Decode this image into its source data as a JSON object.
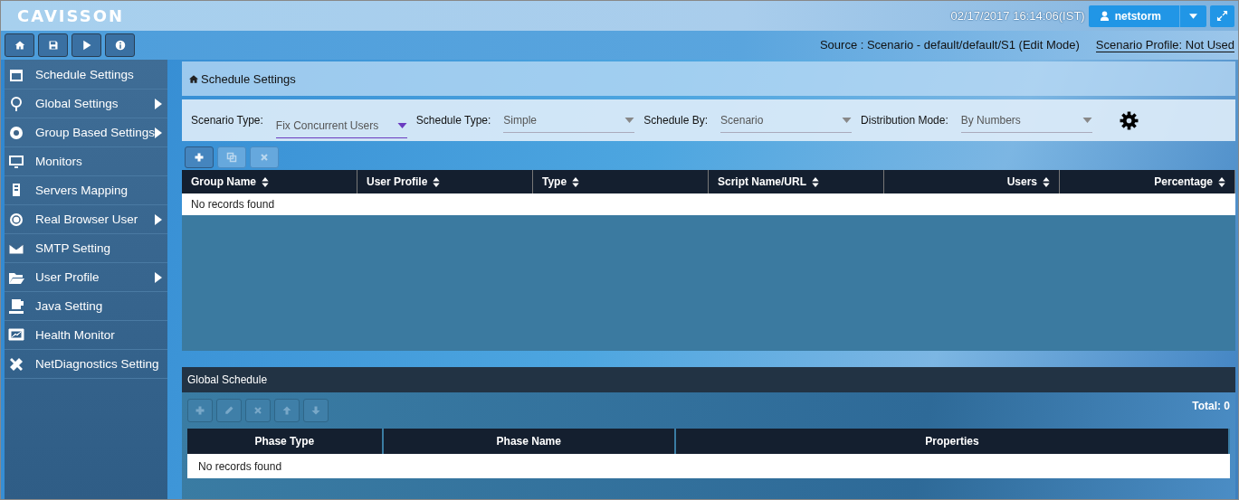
{
  "header": {
    "logo": "CAVISSON",
    "datetime": "02/17/2017 16:14:06(IST)",
    "user": "netstorm"
  },
  "source": "Source : Scenario - default/default/S1 (Edit Mode)",
  "scenario_profile": "Scenario Profile: Not Used",
  "sidebar": {
    "items": [
      {
        "label": "Schedule Settings",
        "submenu": false
      },
      {
        "label": "Global Settings",
        "submenu": true
      },
      {
        "label": "Group Based Settings",
        "submenu": true
      },
      {
        "label": "Monitors",
        "submenu": false
      },
      {
        "label": "Servers Mapping",
        "submenu": false
      },
      {
        "label": "Real Browser User",
        "submenu": true
      },
      {
        "label": "SMTP Setting",
        "submenu": false
      },
      {
        "label": "User Profile",
        "submenu": true
      },
      {
        "label": "Java Setting",
        "submenu": false
      },
      {
        "label": "Health Monitor",
        "submenu": false
      },
      {
        "label": "NetDiagnostics Setting",
        "submenu": false
      }
    ]
  },
  "breadcrumb": "Schedule Settings",
  "filters": [
    {
      "label": "Scenario Type:",
      "value": "Fix Concurrent Users",
      "focused": true
    },
    {
      "label": "Schedule Type:",
      "value": "Simple",
      "focused": false
    },
    {
      "label": "Schedule By:",
      "value": "Scenario",
      "focused": false
    },
    {
      "label": "Distribution Mode:",
      "value": "By Numbers",
      "focused": false
    }
  ],
  "group_toolbar": [
    {
      "disabled": false
    },
    {
      "disabled": true
    },
    {
      "disabled": true
    }
  ],
  "group_table": {
    "columns": [
      {
        "label": "Group Name"
      },
      {
        "label": "User Profile"
      },
      {
        "label": "Type"
      },
      {
        "label": "Script Name/URL"
      },
      {
        "label": "Users"
      },
      {
        "label": "Percentage"
      }
    ],
    "empty": "No records found"
  },
  "global_schedule": {
    "title": "Global Schedule",
    "toolbar": [
      {
        "disabled": true
      },
      {
        "disabled": true
      },
      {
        "disabled": true
      },
      {
        "disabled": true
      },
      {
        "disabled": true
      }
    ],
    "total": "Total: 0",
    "columns": [
      "Phase Type",
      "Phase Name",
      "Properties"
    ],
    "empty": "No records found"
  }
}
